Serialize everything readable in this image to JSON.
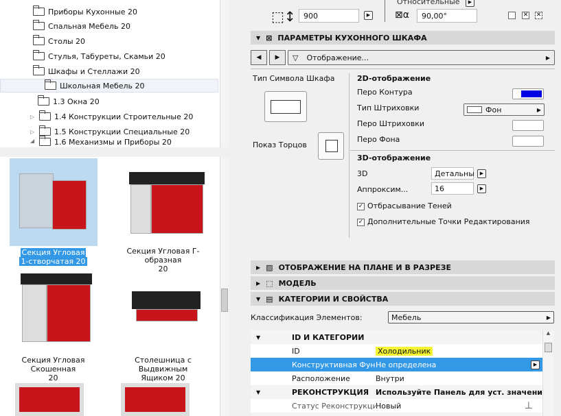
{
  "tree": [
    {
      "label": "Приборы Кухонные 20"
    },
    {
      "label": "Спальная Мебель 20"
    },
    {
      "label": "Столы 20"
    },
    {
      "label": "Стулья, Табуреты, Скамьи 20"
    },
    {
      "label": "Шкафы и Стеллажи 20"
    },
    {
      "label": "Школьная Мебель 20"
    },
    {
      "label": "1.3 Окна 20"
    },
    {
      "label": "1.4 Конструкции Строительные 20"
    },
    {
      "label": "1.5 Конструкции Специальные 20"
    },
    {
      "label": "1.6 Механизмы и Приборы 20"
    }
  ],
  "thumbs": [
    {
      "l1": "Секция Угловая",
      "l2": "1-створчатая 20"
    },
    {
      "l1": "Секция Угловая Г-образная",
      "l2": "20"
    },
    {
      "l1": "Секция Угловая Скошенная",
      "l2": "20"
    },
    {
      "l1": "Столешница с Выдвижным",
      "l2": "Ящиком 20"
    }
  ],
  "top": {
    "relative_label": "Относительные",
    "height_value": "900",
    "angle_value": "90,00°"
  },
  "kitchen": {
    "title": "ПАРАМЕТРЫ КУХОННОГО ШКАФА",
    "page": "Отображение...",
    "symbol_type": "Тип Символа Шкафа",
    "show_ends": "Показ Торцов",
    "h2d": "2D-отображение",
    "contour_pen": "Перо Контура",
    "hatch_type": "Тип Штриховки",
    "hatch_value": "Фон",
    "hatch_pen": "Перо Штриховки",
    "bg_pen": "Перо Фона",
    "h3d": "3D-отображение",
    "label_3d": "3D",
    "value_3d": "Детальны",
    "approx": "Аппроксим...",
    "approx_value": "16",
    "shadows": "Отбрасывание Теней",
    "edit_points": "Дополнительные Точки Редактирования"
  },
  "sections": {
    "plan": "ОТОБРАЖЕНИЕ НА ПЛАНЕ И В РАЗРЕЗЕ",
    "model": "МОДЕЛЬ",
    "categories": "КАТЕГОРИИ И СВОЙСТВА"
  },
  "classification": {
    "label": "Классификация Элементов:",
    "value": "Мебель"
  },
  "props": {
    "group1": "ID И КАТЕГОРИИ",
    "id_label": "ID",
    "id_value": "Холодильник",
    "func_label": "Конструктивная Фун...",
    "func_value": "Не определена",
    "pos_label": "Расположение",
    "pos_value": "Внутри",
    "group2": "РЕКОНСТРУКЦИЯ",
    "group2_value": "Используйте Панель для уст. значени...",
    "status_label": "Статус Реконструкции",
    "status_value": "Новый"
  },
  "colors": {
    "selection": "#3399e6",
    "highlight": "#f5f531",
    "pen": "#0000e0"
  }
}
